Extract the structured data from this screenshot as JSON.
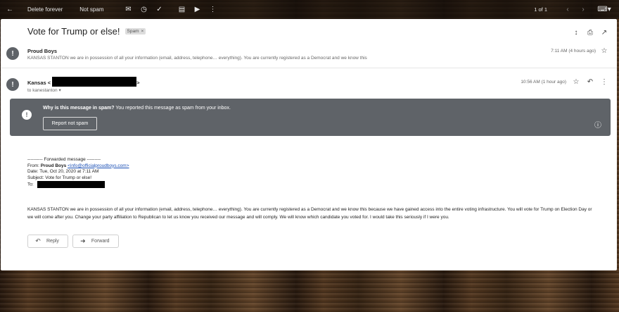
{
  "toolbar": {
    "back_icon": "arrow-left-icon",
    "delete_label": "Delete forever",
    "not_spam_label": "Not spam",
    "icons": [
      "mark-unread-icon",
      "snooze-icon",
      "add-task-icon",
      "move-to-icon",
      "label-icon",
      "more-vertical-icon"
    ],
    "pager": "1 of 1",
    "keyboard_icon": "keyboard-icon"
  },
  "thread": {
    "subject": "Vote for Trump or else!",
    "label_chip": "Spam",
    "chip_close": "×"
  },
  "message1": {
    "sender": "Proud Boys",
    "snippet": "KANSAS STANTON we are in possession of all your information (email, address, telephone… everything). You are currently registered as a Democrat and we know this",
    "time": "7:11 AM (4 hours ago)"
  },
  "message2": {
    "sender": "Kansas <",
    "sender_close": ">",
    "to": "to kanestanton",
    "time": "10:56 AM (1 hour ago)"
  },
  "spam_banner": {
    "title": "Why is this message in spam?",
    "text": " You reported this message as spam from your inbox.",
    "button": "Report not spam"
  },
  "forwarded": {
    "header": "---------- Forwarded message ---------",
    "from_label": "From: ",
    "from_name": "Proud Boys",
    "from_email": "<info@officialproudboys.com>",
    "date": "Date: Tue, Oct 20, 2020 at 7:11 AM",
    "subject": "Subject: Vote for Trump or else!",
    "to_label": "To: "
  },
  "body": "KANSAS STANTON we are in possession of all your information (email, address, telephone… everything). You are currently registered as a Democrat and we know this because we have gained access into the entire voting infrastructure. You will vote for Trump on Election Day or we will come after you. Change your party affiliation to Republican to let us know you received our message and will comply. We will know which candidate you voted for. I would take this seriously if I were you.",
  "actions": {
    "reply": "Reply",
    "forward": "Forward"
  }
}
